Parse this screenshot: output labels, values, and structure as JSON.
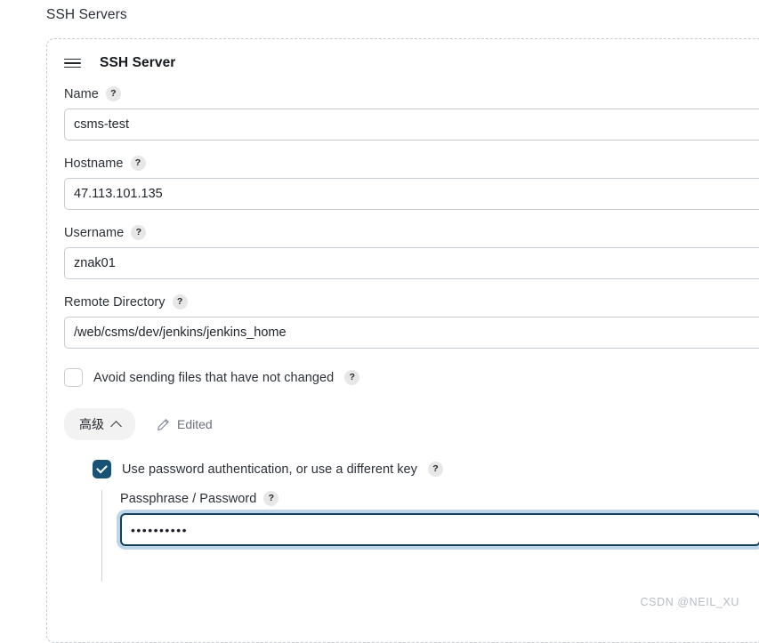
{
  "page": {
    "section_title": "SSH Servers",
    "watermark": "CSDN @NEIL_XU"
  },
  "block": {
    "title": "SSH Server",
    "drag_handle_icon": "hamburger-drag-icon",
    "help_glyph": "?"
  },
  "fields": {
    "name": {
      "label": "Name",
      "value": "csms-test",
      "placeholder": ""
    },
    "hostname": {
      "label": "Hostname",
      "value": "47.113.101.135",
      "placeholder": ""
    },
    "username": {
      "label": "Username",
      "value": "znak01",
      "placeholder": ""
    },
    "remote_directory": {
      "label": "Remote Directory",
      "value": "/web/csms/dev/jenkins/jenkins_home",
      "placeholder": ""
    },
    "passphrase": {
      "label": "Passphrase / Password",
      "value": "••••••••••",
      "placeholder": ""
    }
  },
  "checkboxes": {
    "avoid_sending": {
      "label": "Avoid sending files that have not changed",
      "checked": false
    },
    "use_password_auth": {
      "label": "Use password authentication, or use a different key",
      "checked": true
    }
  },
  "advanced": {
    "button_label": "高级",
    "chevron_icon": "chevron-up-icon",
    "edited_label": "Edited",
    "edited_icon": "pencil-icon"
  },
  "colors": {
    "accent_checked": "#1a5276",
    "focus_border": "#17405c",
    "focus_ring": "#bcd5e8",
    "input_border": "#c6ced4",
    "dashed_border": "#c3cbd3",
    "help_badge_bg": "#e7e7e8",
    "advanced_btn_bg": "#f2f2f3",
    "text_primary": "#2b3137",
    "text_muted": "#6a6f7a",
    "watermark": "#b7bcc4"
  }
}
